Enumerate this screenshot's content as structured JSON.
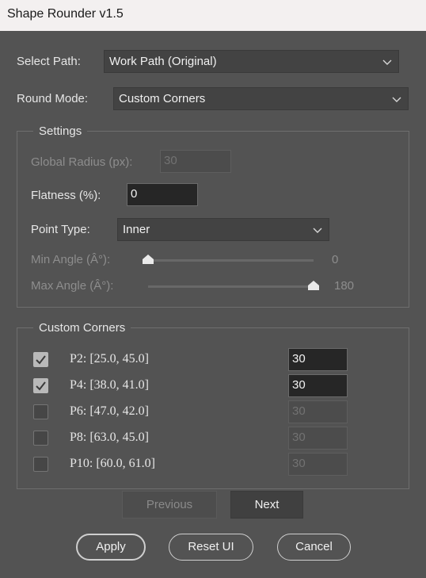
{
  "window": {
    "title": "Shape Rounder v1.5"
  },
  "path": {
    "label": "Select Path:",
    "value": "Work Path (Original)"
  },
  "mode": {
    "label": "Round Mode:",
    "value": "Custom Corners"
  },
  "settings": {
    "title": "Settings",
    "global_radius": {
      "label": "Global Radius (px):",
      "value": "30",
      "enabled": false
    },
    "flatness": {
      "label": "Flatness (%):",
      "value": "0"
    },
    "point_type": {
      "label": "Point Type:",
      "value": "Inner"
    },
    "min_angle": {
      "label": "Min Angle (Â°):",
      "value": "0",
      "level": 0,
      "enabled": false
    },
    "max_angle": {
      "label": "Max Angle (Â°):",
      "value": "180",
      "level": 1,
      "enabled": false
    }
  },
  "custom_corners": {
    "title": "Custom Corners",
    "items": [
      {
        "label": "P2: [25.0, 45.0]",
        "checked": true,
        "radius": "30"
      },
      {
        "label": "P4: [38.0, 41.0]",
        "checked": true,
        "radius": "30"
      },
      {
        "label": "P6: [47.0, 42.0]",
        "checked": false,
        "radius": "30"
      },
      {
        "label": "P8: [63.0, 45.0]",
        "checked": false,
        "radius": "30"
      },
      {
        "label": "P10: [60.0, 61.0]",
        "checked": false,
        "radius": "30"
      }
    ]
  },
  "pager": {
    "previous_label": "Previous",
    "next_label": "Next"
  },
  "actions": {
    "apply_label": "Apply",
    "reset_label": "Reset UI",
    "cancel_label": "Cancel"
  },
  "icons": {
    "dropdown": "chevron-down-icon",
    "check": "checkmark-icon",
    "slider_thumb": "slider-thumb-icon"
  },
  "colors": {
    "background": "#535353",
    "field": "#262626",
    "title_bar": "#f3f0f0"
  }
}
